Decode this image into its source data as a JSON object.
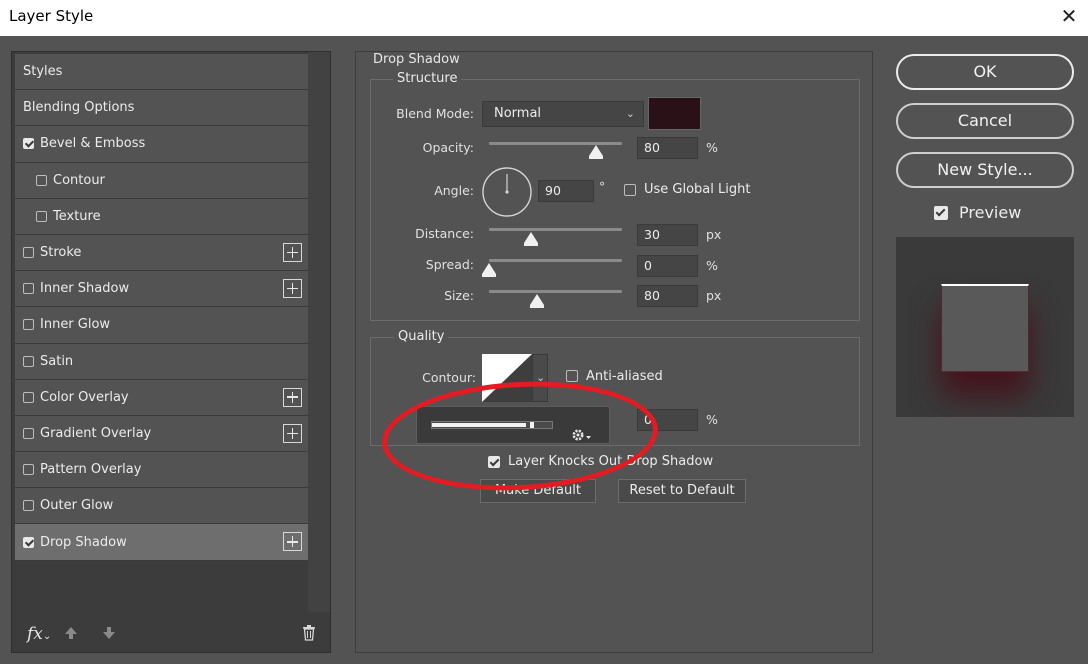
{
  "window": {
    "title": "Layer Style",
    "close_glyph": "✕"
  },
  "styles_panel": {
    "items": [
      {
        "label": "Styles",
        "checkbox": false,
        "checked": false,
        "plus": false,
        "indent": false,
        "active": false
      },
      {
        "label": "Blending Options",
        "checkbox": false,
        "checked": false,
        "plus": false,
        "indent": false,
        "active": false
      },
      {
        "label": "Bevel & Emboss",
        "checkbox": true,
        "checked": true,
        "plus": false,
        "indent": false,
        "active": false
      },
      {
        "label": "Contour",
        "checkbox": true,
        "checked": false,
        "plus": false,
        "indent": true,
        "active": false
      },
      {
        "label": "Texture",
        "checkbox": true,
        "checked": false,
        "plus": false,
        "indent": true,
        "active": false
      },
      {
        "label": "Stroke",
        "checkbox": true,
        "checked": false,
        "plus": true,
        "indent": false,
        "active": false
      },
      {
        "label": "Inner Shadow",
        "checkbox": true,
        "checked": false,
        "plus": true,
        "indent": false,
        "active": false
      },
      {
        "label": "Inner Glow",
        "checkbox": true,
        "checked": false,
        "plus": false,
        "indent": false,
        "active": false
      },
      {
        "label": "Satin",
        "checkbox": true,
        "checked": false,
        "plus": false,
        "indent": false,
        "active": false
      },
      {
        "label": "Color Overlay",
        "checkbox": true,
        "checked": false,
        "plus": true,
        "indent": false,
        "active": false
      },
      {
        "label": "Gradient Overlay",
        "checkbox": true,
        "checked": false,
        "plus": true,
        "indent": false,
        "active": false
      },
      {
        "label": "Pattern Overlay",
        "checkbox": true,
        "checked": false,
        "plus": false,
        "indent": false,
        "active": false
      },
      {
        "label": "Outer Glow",
        "checkbox": true,
        "checked": false,
        "plus": false,
        "indent": false,
        "active": false
      },
      {
        "label": "Drop Shadow",
        "checkbox": true,
        "checked": true,
        "plus": true,
        "indent": false,
        "active": true
      }
    ],
    "footer": {
      "fx_label": "fx",
      "fx_chevron": "⌄"
    }
  },
  "drop_shadow": {
    "section_title": "Drop Shadow",
    "structure": {
      "title": "Structure",
      "blend_mode_label": "Blend Mode:",
      "blend_mode_value": "Normal",
      "shadow_color": "#2a1118",
      "opacity_label": "Opacity:",
      "opacity_value": "80",
      "opacity_unit": "%",
      "opacity_level": 0.8,
      "angle_label": "Angle:",
      "angle_value": "90",
      "angle_unit": "°",
      "use_global_light_label": "Use Global Light",
      "use_global_light_checked": false,
      "distance_label": "Distance:",
      "distance_value": "30",
      "distance_unit": "px",
      "spread_label": "Spread:",
      "spread_value": "0",
      "spread_unit": "%",
      "size_label": "Size:",
      "size_value": "80",
      "size_unit": "px"
    },
    "quality": {
      "title": "Quality",
      "contour_label": "Contour:",
      "anti_aliased_label": "Anti-aliased",
      "anti_aliased_checked": false,
      "noise_value": "0",
      "noise_unit": "%"
    },
    "layer_knocks_label": "Layer Knocks Out Drop Shadow",
    "layer_knocks_checked": true,
    "make_default_label": "Make Default",
    "reset_default_label": "Reset to Default"
  },
  "actions": {
    "ok_label": "OK",
    "cancel_label": "Cancel",
    "new_style_label": "New Style...",
    "preview_label": "Preview",
    "preview_checked": true
  },
  "colors": {
    "dialog_bg": "#535353",
    "panel_dark": "#3c3c3c",
    "highlight_ring": "#e31c23"
  }
}
